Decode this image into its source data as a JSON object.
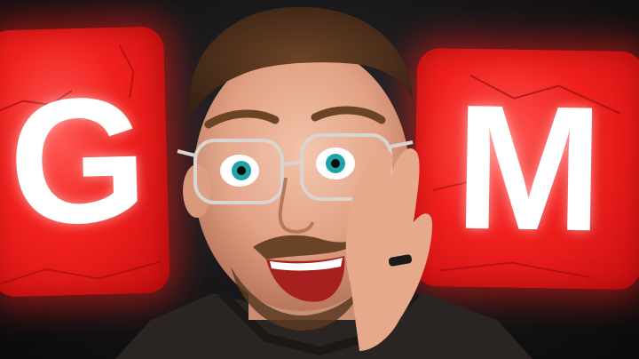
{
  "thumbnail": {
    "left_tile": {
      "letter": "G",
      "color": "#f0201d"
    },
    "right_tile": {
      "letter": "M",
      "color": "#f0201d"
    },
    "background_color": "#161618",
    "subject": {
      "eye_color": "#1fa3a6",
      "sweater_color": "#2a2522"
    }
  }
}
